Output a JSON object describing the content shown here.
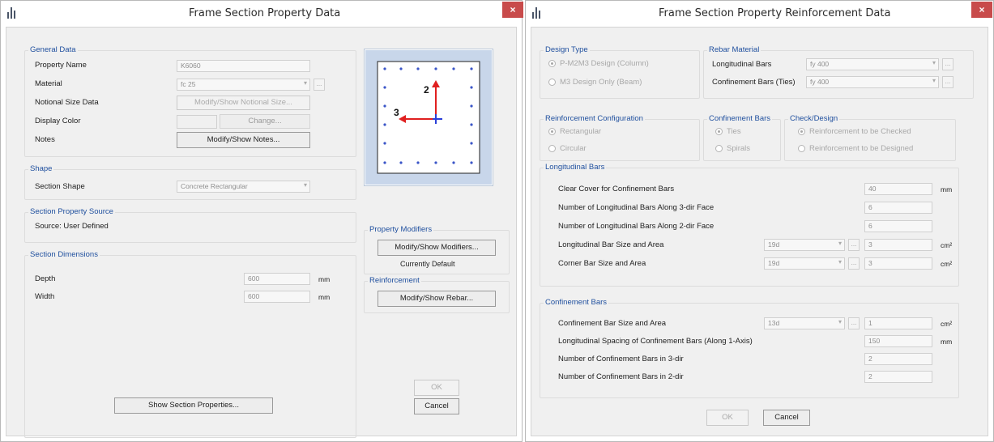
{
  "left": {
    "title": "Frame Section Property Data",
    "general": {
      "heading": "General Data",
      "property_name_label": "Property Name",
      "property_name": "K6060",
      "material_label": "Material",
      "material": "fc 25",
      "notional_label": "Notional Size Data",
      "notional_button": "Modify/Show Notional Size...",
      "color_label": "Display Color",
      "color_button": "Change...",
      "notes_label": "Notes",
      "notes_button": "Modify/Show Notes..."
    },
    "shape": {
      "heading": "Shape",
      "label": "Section Shape",
      "value": "Concrete Rectangular"
    },
    "source": {
      "heading": "Section Property Source",
      "text": "Source:  User Defined"
    },
    "dims": {
      "heading": "Section Dimensions",
      "depth_label": "Depth",
      "depth": "600",
      "depth_unit": "mm",
      "width_label": "Width",
      "width": "600",
      "width_unit": "mm"
    },
    "preview": {
      "axis2": "2",
      "axis3": "3"
    },
    "modifiers": {
      "heading": "Property Modifiers",
      "button": "Modify/Show Modifiers...",
      "status": "Currently Default"
    },
    "rebar": {
      "heading": "Reinforcement",
      "button": "Modify/Show Rebar..."
    },
    "show_props_button": "Show Section Properties...",
    "ok": "OK",
    "cancel": "Cancel"
  },
  "right": {
    "title": "Frame Section Property Reinforcement Data",
    "design_type": {
      "heading": "Design Type",
      "opt1": "P-M2M3 Design (Column)",
      "opt2": "M3 Design Only (Beam)"
    },
    "rebar_material": {
      "heading": "Rebar Material",
      "long_label": "Longitudinal Bars",
      "long_value": "fy 400",
      "conf_label": "Confinement Bars (Ties)",
      "conf_value": "fy 400"
    },
    "config": {
      "heading": "Reinforcement Configuration",
      "opt1": "Rectangular",
      "opt2": "Circular"
    },
    "conf_type": {
      "heading": "Confinement Bars",
      "opt1": "Ties",
      "opt2": "Spirals"
    },
    "check": {
      "heading": "Check/Design",
      "opt1": "Reinforcement to be Checked",
      "opt2": "Reinforcement to be Designed"
    },
    "long": {
      "heading": "Longitudinal Bars",
      "cover_label": "Clear Cover for Confinement Bars",
      "cover": "40",
      "cover_unit": "mm",
      "n3_label": "Number of Longitudinal Bars Along 3-dir Face",
      "n3": "6",
      "n2_label": "Number of Longitudinal Bars Along 2-dir Face",
      "n2": "6",
      "size_label": "Longitudinal Bar Size and Area",
      "size": "19d",
      "area": "3",
      "area_unit": "cm²",
      "corner_label": "Corner Bar Size and Area",
      "corner_size": "19d",
      "corner_area": "3",
      "corner_unit": "cm²"
    },
    "conf": {
      "heading": "Confinement Bars",
      "size_label": "Confinement Bar Size and Area",
      "size": "13d",
      "area": "1",
      "area_unit": "cm²",
      "spacing_label": "Longitudinal Spacing of Confinement Bars (Along 1-Axis)",
      "spacing": "150",
      "spacing_unit": "mm",
      "n3_label": "Number of Confinement Bars in 3-dir",
      "n3": "2",
      "n2_label": "Number of Confinement Bars in 2-dir",
      "n2": "2"
    },
    "ok": "OK",
    "cancel": "Cancel"
  },
  "close_glyph": "×",
  "ellipsis": "...",
  "dropdown_glyph": "▾",
  "colors": {
    "close": "#c84b4b",
    "group_label": "#1f4f9e",
    "axis2": "#e02020",
    "axis3": "#e02020",
    "axis_h": "#2a3fd8"
  }
}
